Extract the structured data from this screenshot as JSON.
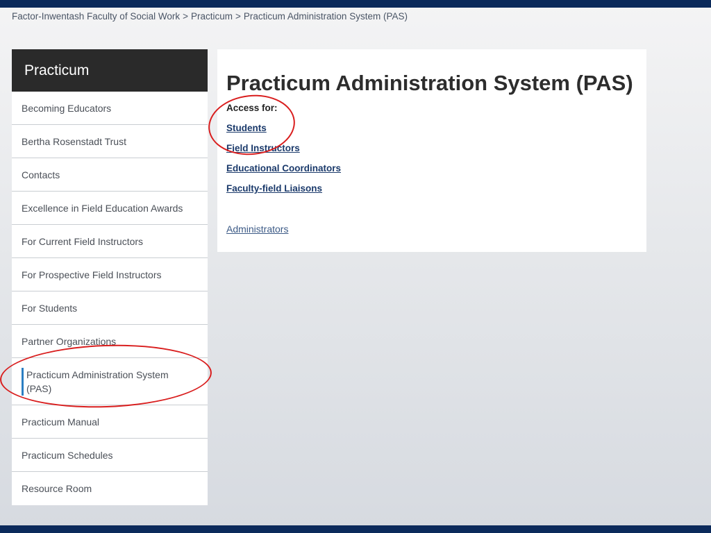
{
  "breadcrumb": {
    "items": [
      "Factor-Inwentash Faculty of Social Work",
      "Practicum",
      "Practicum Administration System (PAS)"
    ],
    "separator": ">"
  },
  "sidebar": {
    "title": "Practicum",
    "items": [
      {
        "label": "Becoming Educators"
      },
      {
        "label": "Bertha Rosenstadt Trust"
      },
      {
        "label": "Contacts"
      },
      {
        "label": "Excellence in Field Education Awards"
      },
      {
        "label": "For Current Field Instructors"
      },
      {
        "label": "For Prospective Field Instructors"
      },
      {
        "label": "For Students"
      },
      {
        "label": "Partner Organizations"
      },
      {
        "label": "Practicum Administration System (PAS)"
      },
      {
        "label": "Practicum Manual"
      },
      {
        "label": "Practicum Schedules"
      },
      {
        "label": "Resource Room"
      }
    ],
    "active_index": 8
  },
  "main": {
    "title": "Practicum Administration System (PAS)",
    "access_label": "Access for:",
    "links": [
      "Students",
      "Field Instructors",
      "Educational Coordinators",
      "Faculty-field Liaisons"
    ],
    "admin_link": "Administrators"
  },
  "colors": {
    "top_bar": "#0b2a5b",
    "sidebar_header": "#2a2a2a",
    "link": "#1b3a6b",
    "annotation": "#d91e1e",
    "active_marker": "#2b7fc3"
  }
}
